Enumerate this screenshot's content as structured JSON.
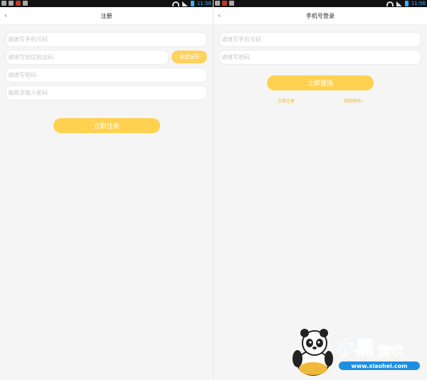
{
  "left": {
    "status": {
      "time": "11:56"
    },
    "nav": {
      "back": "‹",
      "title": "注册"
    },
    "phone_placeholder": "请填写手机号码",
    "sms_placeholder": "请填写短信验证码",
    "send_code_label": "发验证码",
    "password_placeholder": "请填写密码",
    "confirm_placeholder": "请再次输入密码",
    "submit_label": "立即注册"
  },
  "right": {
    "status": {
      "time": "11:56"
    },
    "nav": {
      "back": "‹",
      "title": "手机号登录"
    },
    "phone_placeholder": "请填写手机号码",
    "password_placeholder": "请填写密码",
    "submit_label": "立即登陆",
    "register_link": "立即注册",
    "forgot_link": "找回密码?"
  },
  "watermark": {
    "brand": "小黑游戏",
    "site": "www.xiaohei.com"
  },
  "colors": {
    "accent": "#ffd14f",
    "link": "#f2b62b",
    "status_time": "#3ab0ff"
  }
}
